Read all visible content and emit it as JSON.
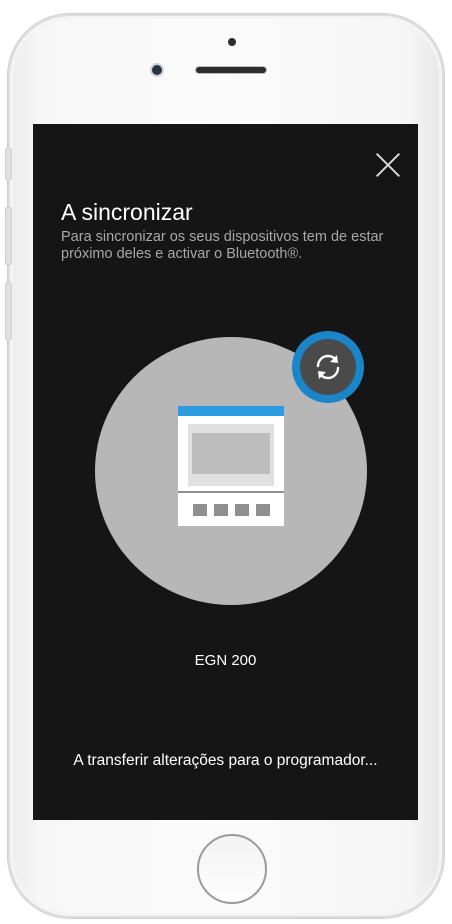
{
  "sync_screen": {
    "title": "A sincronizar",
    "subtitle": "Para sincronizar os seus dispositivos tem de estar próximo deles e activar o Bluetooth®.",
    "device_name": "EGN 200",
    "status": "A transferir alterações para o programador...",
    "close_icon": "close-icon",
    "sync_icon": "sync-icon",
    "device_icon": "timer-device-icon"
  },
  "colors": {
    "screen_background": "#151515",
    "circle": "#b7b7b7",
    "accent_blue": "#1a86c9",
    "badge_inner": "#4a4a4a",
    "device_header": "#2d9be0"
  }
}
